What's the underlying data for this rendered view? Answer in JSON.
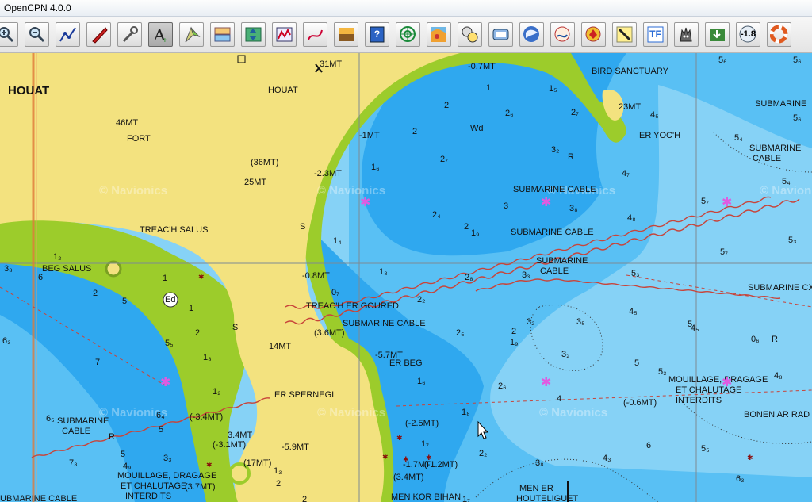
{
  "window": {
    "title": "OpenCPN 4.0.0"
  },
  "toolbar": {
    "buttons": [
      {
        "name": "zoom-in-button",
        "icon": "zoom-in-icon"
      },
      {
        "name": "zoom-out-button",
        "icon": "zoom-out-icon"
      },
      {
        "name": "route-button",
        "icon": "route-icon"
      },
      {
        "name": "follow-ship-button",
        "icon": "ship-icon"
      },
      {
        "name": "settings-button",
        "icon": "wrench-icon"
      },
      {
        "name": "text-button",
        "icon": "text-icon",
        "active": true
      },
      {
        "name": "measure-button",
        "icon": "compass-icon"
      },
      {
        "name": "quilt-button",
        "icon": "quilt-icon"
      },
      {
        "name": "depth-button",
        "icon": "depth-icon"
      },
      {
        "name": "ais-button",
        "icon": "ais-icon"
      },
      {
        "name": "track-button",
        "icon": "track-icon"
      },
      {
        "name": "color-scheme-button",
        "icon": "color-scheme-icon"
      },
      {
        "name": "help-button",
        "icon": "help-icon",
        "text": "?"
      },
      {
        "name": "radar-button",
        "icon": "radar-icon"
      },
      {
        "name": "grib-button",
        "icon": "grib-icon"
      },
      {
        "name": "dashboard-button",
        "icon": "dashboard-icon"
      },
      {
        "name": "objsearch-button",
        "icon": "objsearch-icon"
      },
      {
        "name": "google-earth-button",
        "icon": "globe-icon"
      },
      {
        "name": "tides-button",
        "icon": "tides-icon"
      },
      {
        "name": "weather-button",
        "icon": "weather-icon"
      },
      {
        "name": "marker-button",
        "icon": "marker-icon"
      },
      {
        "name": "tf-button",
        "icon": "tf-icon",
        "text": "TF"
      },
      {
        "name": "wolf-button",
        "icon": "wolf-icon"
      },
      {
        "name": "download-button",
        "icon": "download-icon"
      },
      {
        "name": "offset-button",
        "icon": "offset-icon",
        "text": "-1.8"
      },
      {
        "name": "mob-button",
        "icon": "lifebuoy-icon"
      }
    ]
  },
  "colors": {
    "land": "#f3e27f",
    "drying": "#9ccc2b",
    "shallow": "#2fa8ef",
    "medium": "#59c0f4",
    "deep": "#86d2f6",
    "cable": "#c8443a"
  },
  "chart": {
    "watermark": "© Navionics",
    "labels": {
      "houat_big": "HOUAT",
      "houat": "HOUAT",
      "fort": "FORT",
      "trech_salus": "TREAC'H SALUS",
      "beg_salus": "BEG SALUS",
      "er_spernegi": "ER SPERNEGI",
      "bird_sanctuary": "BIRD SANCTUARY",
      "er_yoch": "ER YOC'H",
      "wd": "Wd",
      "submarine_cable": "SUBMARINE CABLE",
      "submarine": "SUBMARINE",
      "cable": "CABLE",
      "trech_er_goured": "TREAC'H ER GOURED",
      "er_beg": "ER BEG",
      "mouillage": "MOUILLAGE, DRAGAGE",
      "chalutage": "ET CHALUTAGE",
      "interdits": "INTERDITS",
      "bonen_ar_rad": "BONEN AR RAD",
      "men_er": "MEN ER",
      "houteliguet": "HOUTELIGUET",
      "men_kor_bihan": "MEN KOR BIHAN",
      "submarine_cx": "SUBMARINE CX",
      "submarine_cable_cut": "UBMARINE CABLE",
      "r": "R"
    },
    "heights": {
      "h31": "31MT",
      "h46": "46MT",
      "h36": "(36MT)",
      "h25": "25MT",
      "h23": "23MT",
      "h14": "14MT",
      "h34": "3.4MT",
      "h17": "(17MT)",
      "h37": "(3.7MT)",
      "h59": "-5.9MT",
      "h31n": "(-3.1MT)",
      "h34n": "(-3.4MT)"
    },
    "contours": {
      "m07": "-0.7MT",
      "m1": "-1MT",
      "m23": "-2.3MT",
      "m08": "-0.8MT",
      "m57": "-5.7MT",
      "m36": "(3.6MT)",
      "m25": "(-2.5MT)",
      "m17": "-1.7MT",
      "m2": "(-1.2MT)",
      "m34": "(3.4MT)",
      "m06": "(-0.6MT)"
    }
  }
}
